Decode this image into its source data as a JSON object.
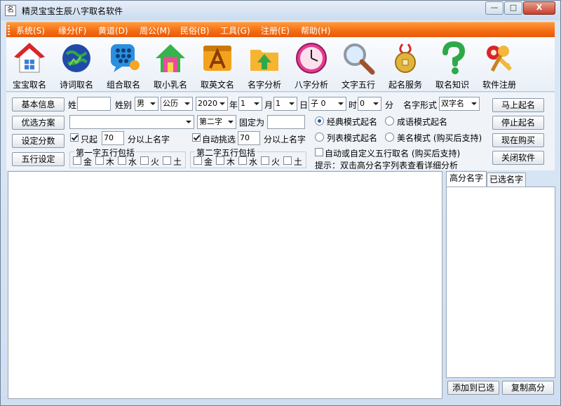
{
  "window": {
    "title": "精灵宝宝生辰八字取名软件",
    "icon_text": "名",
    "buttons": {
      "minimize": "—",
      "maximize": "□",
      "close": "X"
    }
  },
  "menu": [
    "系统(S)",
    "缘分(F)",
    "黄道(D)",
    "周公(M)",
    "民俗(B)",
    "工具(G)",
    "注册(E)",
    "帮助(H)"
  ],
  "toolbar": [
    {
      "label": "宝宝取名",
      "icon": "house-icon"
    },
    {
      "label": "诗词取名",
      "icon": "globe-icon"
    },
    {
      "label": "组合取名",
      "icon": "keypad-chat-icon"
    },
    {
      "label": "取小乳名",
      "icon": "small-house-icon"
    },
    {
      "label": "取英文名",
      "icon": "letter-a-icon"
    },
    {
      "label": "名字分析",
      "icon": "upload-folder-icon"
    },
    {
      "label": "八字分析",
      "icon": "clock-icon"
    },
    {
      "label": "文字五行",
      "icon": "magnifier-icon"
    },
    {
      "label": "起名服务",
      "icon": "coin-charm-icon"
    },
    {
      "label": "取名知识",
      "icon": "question-icon"
    },
    {
      "label": "软件注册",
      "icon": "keys-icon"
    }
  ],
  "form": {
    "left_buttons": [
      "基本信息",
      "优选方案",
      "设定分数",
      "五行设定"
    ],
    "surname_label": "姓",
    "surname_value": "",
    "gender_label": "姓别",
    "gender_value": "男",
    "calendar_value": "公历",
    "year_value": "2020",
    "year_label": "年",
    "month_value": "1",
    "month_label": "月",
    "day_value": "1",
    "day_label": "日",
    "hour_value": "子 0",
    "hour_label": "时",
    "minute_value": "0",
    "minute_label": "分",
    "name_form_label": "名字形式",
    "name_form_value": "双字名",
    "scheme_value": "",
    "second_char_value": "第二字",
    "fixed_label": "固定为",
    "fixed_value": "",
    "only_label": "只起",
    "only_checked": true,
    "only_score": "70",
    "only_suffix": "分以上名字",
    "auto_label": "自动挑选",
    "auto_checked": true,
    "auto_score": "70",
    "auto_suffix": "分以上名字",
    "group1_title": "第一字五行包括",
    "group2_title": "第二字五行包括",
    "elements": [
      "金",
      "木",
      "水",
      "火",
      "土"
    ],
    "modes": [
      {
        "label": "经典模式起名",
        "checked": true
      },
      {
        "label": "成语模式起名",
        "checked": false
      },
      {
        "label": "列表模式起名",
        "checked": false
      },
      {
        "label": "美名模式 (购买后支持)",
        "checked": false
      }
    ],
    "custom_wuxing_label": "自动或自定义五行取名 (购买后支持)",
    "hint": "提示：双击高分名字列表查看详细分析",
    "right_buttons": [
      "马上起名",
      "停止起名",
      "现在购买",
      "关闭软件"
    ]
  },
  "side": {
    "tabs": [
      "高分名字",
      "已选名字"
    ],
    "active_tab": 0,
    "bottom_buttons": [
      "添加到已选",
      "复制高分"
    ]
  },
  "colors": {
    "menu_bg": "#f36b11",
    "window_bg": "#dbe8f6",
    "accent_radio": "#1e56b0"
  }
}
